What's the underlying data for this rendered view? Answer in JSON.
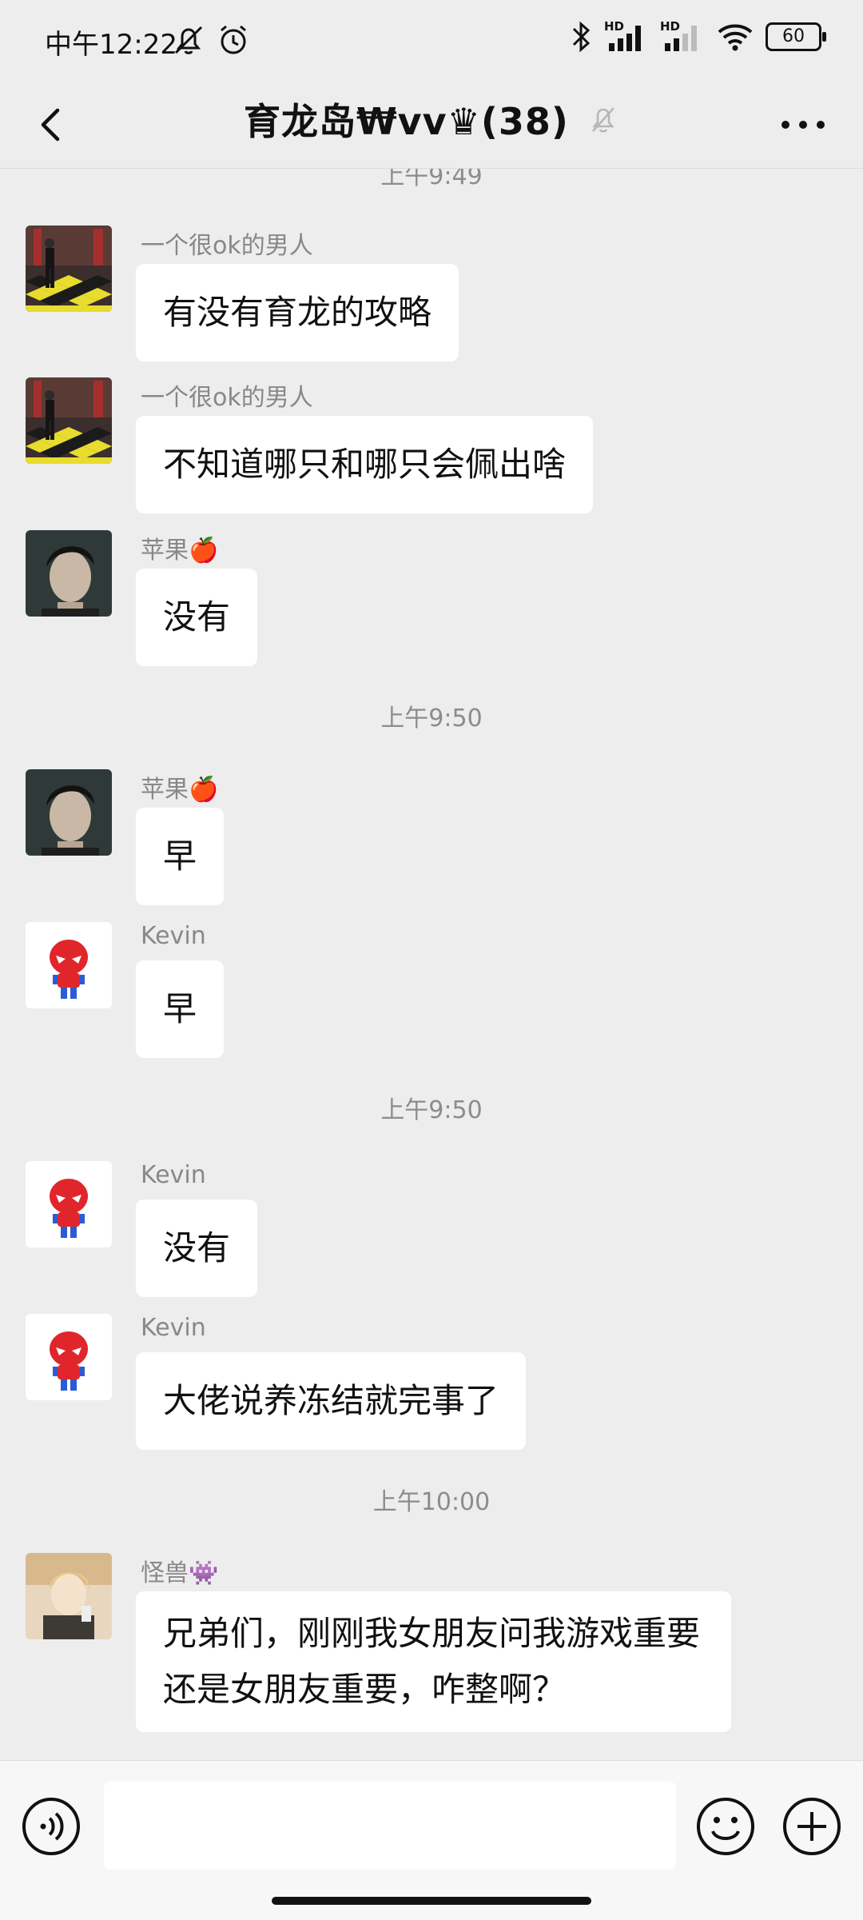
{
  "status_bar": {
    "time": "中午12:22",
    "battery": "60",
    "hd1": "HD",
    "hd2": "HD"
  },
  "header": {
    "title": "育龙岛₩vv♛(38)",
    "back_icon": "chevron-left-icon",
    "mute_icon": "bell-off-icon",
    "more_icon": "more-dots-icon"
  },
  "timestamps": [
    "上午9:49",
    "上午9:50",
    "上午9:50",
    "上午10:00"
  ],
  "messages": [
    {
      "sender": "一个很ok的男人",
      "text": "有没有育龙的攻略"
    },
    {
      "sender": "一个很ok的男人",
      "text": "不知道哪只和哪只会佩出啥"
    },
    {
      "sender": "苹果🍎",
      "text": "没有"
    },
    {
      "sender": "苹果🍎",
      "text": "早"
    },
    {
      "sender": "Kevin",
      "text": "早"
    },
    {
      "sender": "Kevin",
      "text": "没有"
    },
    {
      "sender": "Kevin",
      "text": "大佬说养冻结就完事了"
    },
    {
      "sender": "怪兽👾",
      "text": "兄弟们，刚刚我女朋友问我游戏重要还是女朋友重要，咋整啊？"
    }
  ],
  "input": {
    "value": "",
    "placeholder": ""
  },
  "colors": {
    "background": "#ededed",
    "bubble": "#ffffff",
    "input_bar": "#f7f7f7"
  }
}
